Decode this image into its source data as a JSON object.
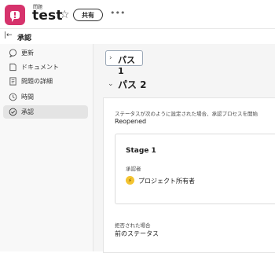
{
  "header": {
    "object_type": "問題",
    "title": "test",
    "share_label": "共有",
    "brand_color": "#d6336c"
  },
  "subheader": {
    "title": "承認"
  },
  "sidebar": {
    "items": [
      {
        "label": "更新",
        "icon": "comment-icon"
      },
      {
        "label": "ドキュメント",
        "icon": "document-icon"
      },
      {
        "label": "問題の詳細",
        "icon": "details-icon"
      },
      {
        "label": "時間",
        "icon": "clock-icon"
      },
      {
        "label": "承認",
        "icon": "check-circle-icon",
        "active": true
      }
    ]
  },
  "main": {
    "path1": {
      "title": "パス 1",
      "expanded": false
    },
    "path2": {
      "title": "パス 2",
      "expanded": true,
      "condition_label": "ステータスが次のように設定された場合、承認プロセスを開始",
      "condition_value": "Reopened",
      "stage": {
        "title": "Stage 1",
        "approver_label": "承認者",
        "approver_name": "プロジェクト所有者",
        "approver_icon": "bolt-icon"
      },
      "reject_label": "拒否された場合",
      "reject_value": "前のステータス"
    }
  }
}
